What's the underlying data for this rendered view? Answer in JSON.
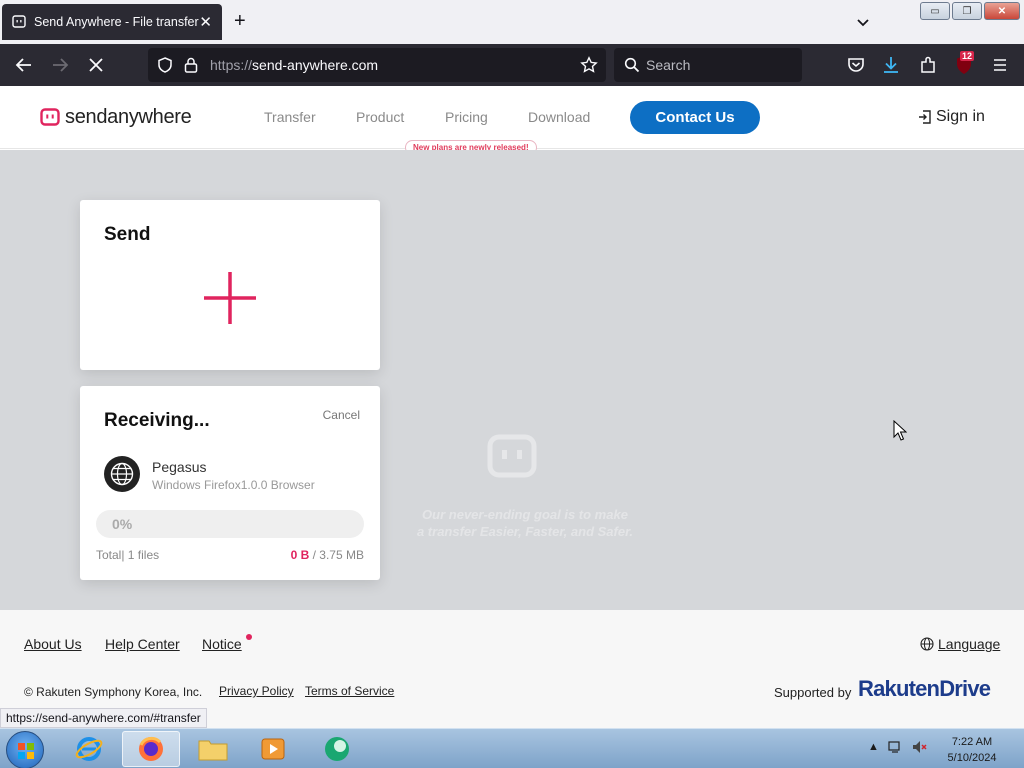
{
  "browser": {
    "tab_title": "Send Anywhere - File transfer",
    "url_scheme": "https://",
    "url_host": "send-anywhere.com",
    "search_placeholder": "Search",
    "extension_badge": "12",
    "status_url": "https://send-anywhere.com/#transfer"
  },
  "site": {
    "logo_send": "send",
    "logo_anywhere": "anywhere",
    "menu": [
      "Transfer",
      "Product",
      "Pricing",
      "Download"
    ],
    "new_plans_badge": "New plans are newly released!",
    "contact_label": "Contact Us",
    "signin_label": "Sign in",
    "accent_color": "#e0245e",
    "brand_blue": "#0d6fc4"
  },
  "send_card": {
    "title": "Send"
  },
  "receive_card": {
    "title": "Receiving...",
    "cancel_label": "Cancel",
    "sender_name": "Pegasus",
    "sender_device": "Windows Firefox1.0.0 Browser",
    "progress_text": "0%",
    "progress_fraction": 0,
    "total_text": "Total| 1 files",
    "received_text": "0 B",
    "size_text": " / 3.75 MB"
  },
  "slogan": {
    "line1": "Our never-ending goal is to make",
    "line2": "a transfer Easier, Faster, and Safer."
  },
  "footer": {
    "about": "About Us",
    "help": "Help Center",
    "notice": "Notice",
    "language": "Language",
    "copyright": "© Rakuten Symphony Korea, Inc.",
    "privacy": "Privacy Policy",
    "terms": "Terms of Service",
    "supported_by": "Supported by",
    "rakuten_word": "Rakuten",
    "drive_word": "Drive"
  },
  "taskbar": {
    "time": "7:22 AM",
    "date": "5/10/2024"
  }
}
